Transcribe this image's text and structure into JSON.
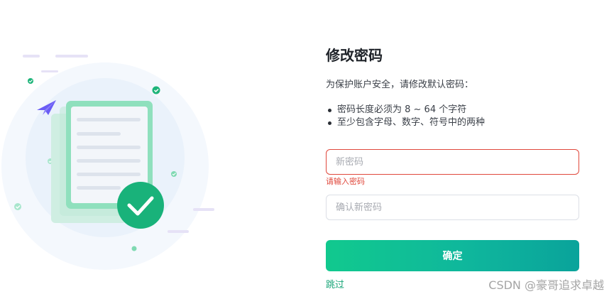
{
  "form": {
    "title": "修改密码",
    "description": "为保护账户安全，请修改默认密码：",
    "rules": [
      "密码长度必须为 8 ~ 64 个字符",
      "至少包含字母、数字、符号中的两种"
    ],
    "new_password": {
      "value": "",
      "placeholder": "新密码",
      "error": "请输入密码"
    },
    "confirm_password": {
      "value": "",
      "placeholder": "确认新密码"
    },
    "submit_label": "确定",
    "skip_label": "跳过"
  },
  "watermark": "CSDN @豪哥追求卓越",
  "colors": {
    "accent": "#11c98e",
    "accent_dark": "#0aa39b",
    "error": "#e0483c",
    "link": "#18a578",
    "illustration_green": "#1db479",
    "illustration_purple": "#6a5cf5"
  },
  "icons": {
    "illustration": "document-checkmark-illustration",
    "paper_plane": "paper-plane-icon",
    "check": "check-circle-icon"
  }
}
